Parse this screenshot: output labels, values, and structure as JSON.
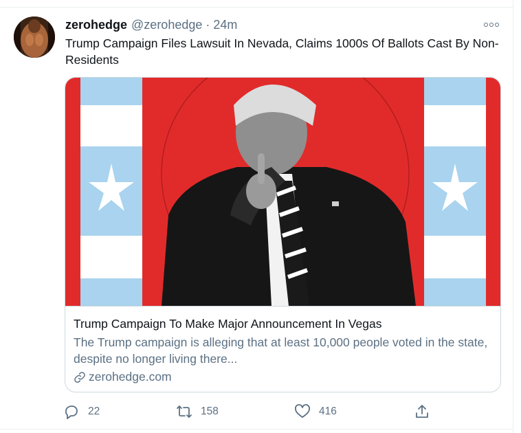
{
  "tweet": {
    "author_name": "zerohedge",
    "author_handle": "@zerohedge",
    "separator": "·",
    "timestamp": "24m",
    "text": "Trump Campaign Files Lawsuit In Nevada, Claims 1000s Of Ballots Cast By Non-Residents"
  },
  "card": {
    "title": "Trump Campaign To Make Major Announcement In Vegas",
    "description": "The Trump campaign is alleging that at least 10,000 people voted in the state, despite no longer living there...",
    "domain": "zerohedge.com"
  },
  "actions": {
    "reply_count": "22",
    "retweet_count": "158",
    "like_count": "416"
  },
  "colors": {
    "text_primary": "#0f1419",
    "text_secondary": "#5b7083",
    "border": "#cfd9de",
    "image_red": "#e12b2b",
    "image_flag_blue": "#a9d3ee"
  },
  "icons": [
    "more-icon",
    "link-icon",
    "reply-icon",
    "retweet-icon",
    "like-icon",
    "share-icon"
  ]
}
